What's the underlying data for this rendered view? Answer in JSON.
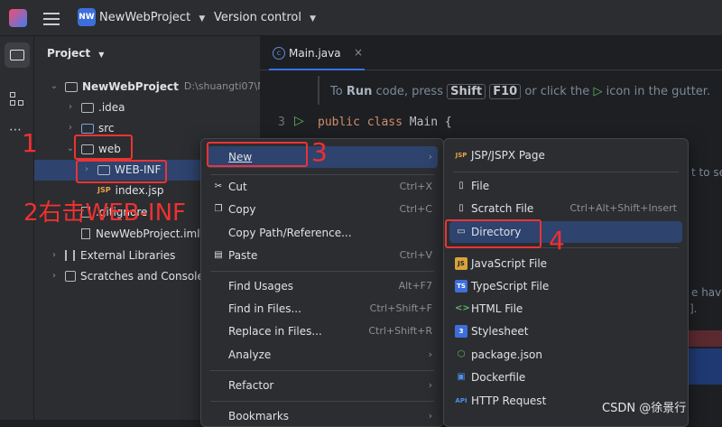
{
  "titlebar": {
    "project_badge": "NW",
    "project_name": "NewWebProject",
    "vcs": "Version control"
  },
  "panel": {
    "title": "Project"
  },
  "tree": [
    {
      "label": "NewWebProject",
      "hint": "D:\\shuangti07\\N"
    },
    {
      "label": ".idea"
    },
    {
      "label": "src"
    },
    {
      "label": "web"
    },
    {
      "label": "WEB-INF"
    },
    {
      "label": "index.jsp"
    },
    {
      "label": ".gitignore"
    },
    {
      "label": "NewWebProject.iml"
    },
    {
      "label": "External Libraries"
    },
    {
      "label": "Scratches and Consoles"
    }
  ],
  "editor": {
    "tab": "Main.java",
    "hint_prefix": "To",
    "hint_run": "Run",
    "hint_mid": "code, press",
    "key1": "Shift",
    "key2": "F10",
    "hint_suffix": "or click the",
    "hint_end": "icon in the gutter.",
    "line_no": "3",
    "code_kw": "public class",
    "code_name": "Main {",
    "frag1": "t to see",
    "frag2": "e have",
    "frag3": "]."
  },
  "context_menu": {
    "items": [
      {
        "label": "New",
        "shortcut": ""
      },
      {
        "label": "Cut",
        "shortcut": "Ctrl+X"
      },
      {
        "label": "Copy",
        "shortcut": "Ctrl+C"
      },
      {
        "label": "Copy Path/Reference...",
        "shortcut": ""
      },
      {
        "label": "Paste",
        "shortcut": "Ctrl+V"
      },
      {
        "label": "Find Usages",
        "shortcut": "Alt+F7"
      },
      {
        "label": "Find in Files...",
        "shortcut": "Ctrl+Shift+F"
      },
      {
        "label": "Replace in Files...",
        "shortcut": "Ctrl+Shift+R"
      },
      {
        "label": "Analyze",
        "shortcut": ""
      },
      {
        "label": "Refactor",
        "shortcut": ""
      },
      {
        "label": "Bookmarks",
        "shortcut": ""
      }
    ]
  },
  "submenu": {
    "items": [
      {
        "label": "JSP/JSPX Page",
        "shortcut": ""
      },
      {
        "label": "File",
        "shortcut": ""
      },
      {
        "label": "Scratch File",
        "shortcut": "Ctrl+Alt+Shift+Insert"
      },
      {
        "label": "Directory",
        "shortcut": ""
      },
      {
        "label": "JavaScript File",
        "shortcut": ""
      },
      {
        "label": "TypeScript File",
        "shortcut": ""
      },
      {
        "label": "HTML File",
        "shortcut": ""
      },
      {
        "label": "Stylesheet",
        "shortcut": ""
      },
      {
        "label": "package.json",
        "shortcut": ""
      },
      {
        "label": "Dockerfile",
        "shortcut": ""
      },
      {
        "label": "HTTP Request",
        "shortcut": ""
      }
    ]
  },
  "annotations": {
    "n1": "1",
    "n2": "2右击WEB-INF",
    "n3": "3",
    "n4": "4"
  },
  "watermark": "CSDN @徐景行",
  "colors": {
    "accent": "#2e436e",
    "annotation": "#ee3333",
    "background": "#1e1f22",
    "panel": "#2b2d30"
  }
}
